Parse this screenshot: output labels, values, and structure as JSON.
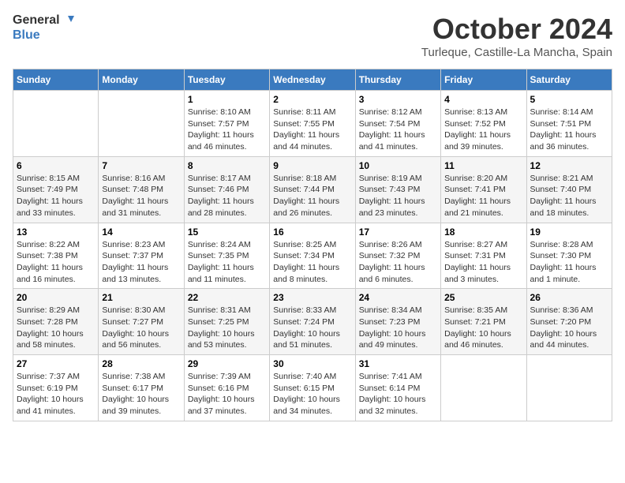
{
  "logo": {
    "line1": "General",
    "line2": "Blue"
  },
  "title": "October 2024",
  "location": "Turleque, Castille-La Mancha, Spain",
  "days_header": [
    "Sunday",
    "Monday",
    "Tuesday",
    "Wednesday",
    "Thursday",
    "Friday",
    "Saturday"
  ],
  "weeks": [
    [
      {
        "day": "",
        "info": ""
      },
      {
        "day": "",
        "info": ""
      },
      {
        "day": "1",
        "info": "Sunrise: 8:10 AM\nSunset: 7:57 PM\nDaylight: 11 hours and 46 minutes."
      },
      {
        "day": "2",
        "info": "Sunrise: 8:11 AM\nSunset: 7:55 PM\nDaylight: 11 hours and 44 minutes."
      },
      {
        "day": "3",
        "info": "Sunrise: 8:12 AM\nSunset: 7:54 PM\nDaylight: 11 hours and 41 minutes."
      },
      {
        "day": "4",
        "info": "Sunrise: 8:13 AM\nSunset: 7:52 PM\nDaylight: 11 hours and 39 minutes."
      },
      {
        "day": "5",
        "info": "Sunrise: 8:14 AM\nSunset: 7:51 PM\nDaylight: 11 hours and 36 minutes."
      }
    ],
    [
      {
        "day": "6",
        "info": "Sunrise: 8:15 AM\nSunset: 7:49 PM\nDaylight: 11 hours and 33 minutes."
      },
      {
        "day": "7",
        "info": "Sunrise: 8:16 AM\nSunset: 7:48 PM\nDaylight: 11 hours and 31 minutes."
      },
      {
        "day": "8",
        "info": "Sunrise: 8:17 AM\nSunset: 7:46 PM\nDaylight: 11 hours and 28 minutes."
      },
      {
        "day": "9",
        "info": "Sunrise: 8:18 AM\nSunset: 7:44 PM\nDaylight: 11 hours and 26 minutes."
      },
      {
        "day": "10",
        "info": "Sunrise: 8:19 AM\nSunset: 7:43 PM\nDaylight: 11 hours and 23 minutes."
      },
      {
        "day": "11",
        "info": "Sunrise: 8:20 AM\nSunset: 7:41 PM\nDaylight: 11 hours and 21 minutes."
      },
      {
        "day": "12",
        "info": "Sunrise: 8:21 AM\nSunset: 7:40 PM\nDaylight: 11 hours and 18 minutes."
      }
    ],
    [
      {
        "day": "13",
        "info": "Sunrise: 8:22 AM\nSunset: 7:38 PM\nDaylight: 11 hours and 16 minutes."
      },
      {
        "day": "14",
        "info": "Sunrise: 8:23 AM\nSunset: 7:37 PM\nDaylight: 11 hours and 13 minutes."
      },
      {
        "day": "15",
        "info": "Sunrise: 8:24 AM\nSunset: 7:35 PM\nDaylight: 11 hours and 11 minutes."
      },
      {
        "day": "16",
        "info": "Sunrise: 8:25 AM\nSunset: 7:34 PM\nDaylight: 11 hours and 8 minutes."
      },
      {
        "day": "17",
        "info": "Sunrise: 8:26 AM\nSunset: 7:32 PM\nDaylight: 11 hours and 6 minutes."
      },
      {
        "day": "18",
        "info": "Sunrise: 8:27 AM\nSunset: 7:31 PM\nDaylight: 11 hours and 3 minutes."
      },
      {
        "day": "19",
        "info": "Sunrise: 8:28 AM\nSunset: 7:30 PM\nDaylight: 11 hours and 1 minute."
      }
    ],
    [
      {
        "day": "20",
        "info": "Sunrise: 8:29 AM\nSunset: 7:28 PM\nDaylight: 10 hours and 58 minutes."
      },
      {
        "day": "21",
        "info": "Sunrise: 8:30 AM\nSunset: 7:27 PM\nDaylight: 10 hours and 56 minutes."
      },
      {
        "day": "22",
        "info": "Sunrise: 8:31 AM\nSunset: 7:25 PM\nDaylight: 10 hours and 53 minutes."
      },
      {
        "day": "23",
        "info": "Sunrise: 8:33 AM\nSunset: 7:24 PM\nDaylight: 10 hours and 51 minutes."
      },
      {
        "day": "24",
        "info": "Sunrise: 8:34 AM\nSunset: 7:23 PM\nDaylight: 10 hours and 49 minutes."
      },
      {
        "day": "25",
        "info": "Sunrise: 8:35 AM\nSunset: 7:21 PM\nDaylight: 10 hours and 46 minutes."
      },
      {
        "day": "26",
        "info": "Sunrise: 8:36 AM\nSunset: 7:20 PM\nDaylight: 10 hours and 44 minutes."
      }
    ],
    [
      {
        "day": "27",
        "info": "Sunrise: 7:37 AM\nSunset: 6:19 PM\nDaylight: 10 hours and 41 minutes."
      },
      {
        "day": "28",
        "info": "Sunrise: 7:38 AM\nSunset: 6:17 PM\nDaylight: 10 hours and 39 minutes."
      },
      {
        "day": "29",
        "info": "Sunrise: 7:39 AM\nSunset: 6:16 PM\nDaylight: 10 hours and 37 minutes."
      },
      {
        "day": "30",
        "info": "Sunrise: 7:40 AM\nSunset: 6:15 PM\nDaylight: 10 hours and 34 minutes."
      },
      {
        "day": "31",
        "info": "Sunrise: 7:41 AM\nSunset: 6:14 PM\nDaylight: 10 hours and 32 minutes."
      },
      {
        "day": "",
        "info": ""
      },
      {
        "day": "",
        "info": ""
      }
    ]
  ]
}
